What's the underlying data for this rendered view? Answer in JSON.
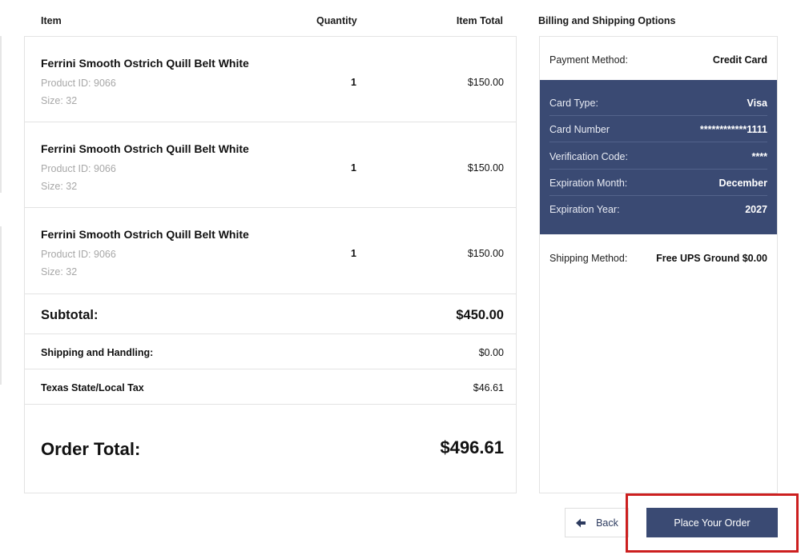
{
  "headers": {
    "item": "Item",
    "quantity": "Quantity",
    "item_total": "Item Total",
    "billing": "Billing and Shipping Options"
  },
  "items": [
    {
      "name": "Ferrini Smooth Ostrich Quill Belt White",
      "product_id": "Product ID: 9066",
      "size": "Size: 32",
      "quantity": "1",
      "price": "$150.00"
    },
    {
      "name": "Ferrini Smooth Ostrich Quill Belt White",
      "product_id": "Product ID: 9066",
      "size": "Size: 32",
      "quantity": "1",
      "price": "$150.00"
    },
    {
      "name": "Ferrini Smooth Ostrich Quill Belt White",
      "product_id": "Product ID: 9066",
      "size": "Size: 32",
      "quantity": "1",
      "price": "$150.00"
    }
  ],
  "summary": {
    "subtotal_label": "Subtotal:",
    "subtotal_value": "$450.00",
    "shipping_label": "Shipping and Handling:",
    "shipping_value": "$0.00",
    "tax_label": "Texas State/Local Tax",
    "tax_value": "$46.61",
    "order_total_label": "Order Total:",
    "order_total_value": "$496.61"
  },
  "billing": {
    "payment_method_label": "Payment Method:",
    "payment_method_value": "Credit Card",
    "card": [
      {
        "label": "Card Type:",
        "value": "Visa"
      },
      {
        "label": "Card Number",
        "value": "************1111"
      },
      {
        "label": "Verification Code:",
        "value": "****"
      },
      {
        "label": "Expiration Month:",
        "value": "December"
      },
      {
        "label": "Expiration Year:",
        "value": "2027"
      }
    ],
    "shipping_method_label": "Shipping Method:",
    "shipping_method_value": "Free UPS Ground $0.00"
  },
  "buttons": {
    "back": "Back",
    "place_order": "Place Your Order"
  },
  "icons": {
    "back": "arrow-left-icon"
  },
  "colors": {
    "accent": "#3a4a73",
    "highlight": "#cc1f1f"
  }
}
